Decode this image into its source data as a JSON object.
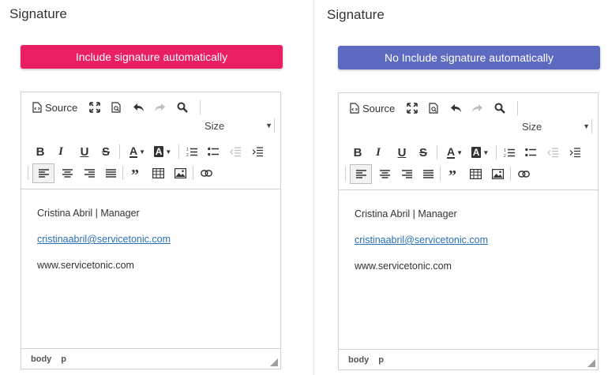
{
  "panels": [
    {
      "title": "Signature",
      "button_label": "Include signature automatically",
      "button_color": "#e91e63",
      "toolbar": {
        "source_label": "Source",
        "size_label": "Size"
      },
      "content": {
        "line1": "Cristina Abril | Manager",
        "email": "cristinaabril@servicetonic.com",
        "website": "www.servicetonic.com"
      },
      "status": {
        "path1": "body",
        "path2": "p"
      }
    },
    {
      "title": "Signature",
      "button_label": "No Include signature automatically",
      "button_color": "#5c6bc0",
      "toolbar": {
        "source_label": "Source",
        "size_label": "Size"
      },
      "content": {
        "line1": "Cristina Abril | Manager",
        "email": "cristinaabril@servicetonic.com",
        "website": "www.servicetonic.com"
      },
      "status": {
        "path1": "body",
        "path2": "p"
      }
    }
  ]
}
